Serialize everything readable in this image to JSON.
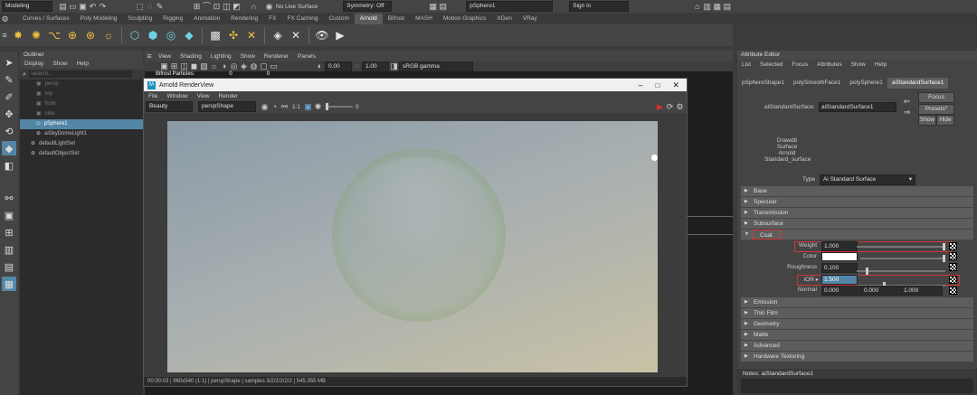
{
  "statusline": {
    "mode": "Modeling",
    "live_surface": "No Live Surface",
    "symmetry": "Symmetry: Off",
    "search_value": "pSphere1",
    "sign_in": "Sign in"
  },
  "shelf": {
    "tabs": [
      "Curves / Surfaces",
      "Poly Modeling",
      "Sculpting",
      "Rigging",
      "Animation",
      "Rendering",
      "FX",
      "FX Caching",
      "Custom",
      "Arnold",
      "Bifrost",
      "MASH",
      "Motion Graphics",
      "XGen",
      "VRay"
    ],
    "active_tab": "Arnold"
  },
  "outliner": {
    "title": "Outliner",
    "menu": [
      "Display",
      "Show",
      "Help"
    ],
    "search_placeholder": "Search...",
    "items": [
      {
        "label": "persp",
        "dim": true
      },
      {
        "label": "top",
        "dim": true
      },
      {
        "label": "front",
        "dim": true
      },
      {
        "label": "side",
        "dim": true
      },
      {
        "label": "pSphere1",
        "dim": false,
        "selected": true
      },
      {
        "label": "aiSkyDomeLight1",
        "dim": false
      },
      {
        "label": "defaultLightSet",
        "dim": false
      },
      {
        "label": "defaultObjectSet",
        "dim": false
      }
    ]
  },
  "viewport": {
    "menu": [
      "View",
      "Shading",
      "Lighting",
      "Show",
      "Renderer",
      "Panels"
    ],
    "value1": "0.00",
    "value2": "1.00",
    "colorspace": "sRGB gamma",
    "hud_label": "Bifrost Particles:",
    "hud_v1": "0",
    "hud_v2": "0"
  },
  "renderview": {
    "title": "Arnold RenderView",
    "menu": [
      "File",
      "Window",
      "View",
      "Render"
    ],
    "aov": "Beauty",
    "camera": "perspShape",
    "ratio": "1:1",
    "exposure": "0",
    "status": "00:00:03 | 960x540 (1:1) | perspShape | samples 3/2/2/2/2/2 | 545.355 MB"
  },
  "attr_editor": {
    "title": "Attribute Editor",
    "menu": [
      "List",
      "Selected",
      "Focus",
      "Attributes",
      "Show",
      "Help"
    ],
    "tabs": [
      "pSphereShape1",
      "polySmoothFace1",
      "polySphere1",
      "aiStandardSurface1"
    ],
    "node_label": "aiStandardSurface:",
    "node_value": "aiStandardSurface1",
    "focus_btn": "Focus",
    "presets_btn": "Presets*",
    "show_btn": "Show",
    "hide_btn": "Hide",
    "classification": [
      "Drawdb",
      "Surface",
      "Arnold",
      "Standard_surface"
    ],
    "type_label": "Type",
    "type_value": "Ai Standard Surface",
    "sections_top": [
      "Base",
      "Specular",
      "Transmission",
      "Subsurface"
    ],
    "coat_section": "Coat",
    "coat": {
      "weight_label": "Weight",
      "weight_value": "1.000",
      "weight_level": 1.0,
      "color_label": "Color",
      "roughness_label": "Roughness",
      "roughness_value": "0.100",
      "roughness_level": 0.1,
      "ior_label": "IOR",
      "ior_value": "1.500",
      "ior_level": 0.3,
      "normal_label": "Normal",
      "normal_x": "0.000",
      "normal_y": "0.000",
      "normal_z": "1.000"
    },
    "sections_bottom": [
      "Emission",
      "Thin Film",
      "Geometry",
      "Matte",
      "Advanced",
      "Hardware Texturing"
    ],
    "notes": "Notes: aiStandardSurface1"
  },
  "colors": {
    "accent": "#5285a6",
    "highlight": "#d03838"
  }
}
